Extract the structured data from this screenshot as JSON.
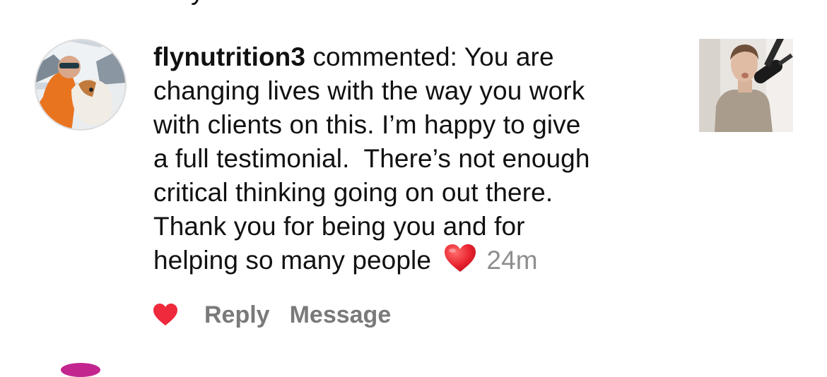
{
  "comment": {
    "username": "flynutrition3",
    "verb": "commented:",
    "lines": [
      "You are",
      "changing lives with the way you work",
      "with clients on this. I’m happy to give",
      "a full testimonial.  There’s not enough",
      "critical thinking going on out there.",
      "Thank you for being you and for",
      "helping so many people"
    ],
    "emoji": "heart-emoji",
    "time": "24m"
  },
  "actions": {
    "like_icon": "heart-icon",
    "like_color": "#ee2a3c",
    "reply_label": "Reply",
    "message_label": "Message"
  },
  "colors": {
    "secondary_text": "#8e8e8e",
    "action_text": "#7a7a7a"
  }
}
